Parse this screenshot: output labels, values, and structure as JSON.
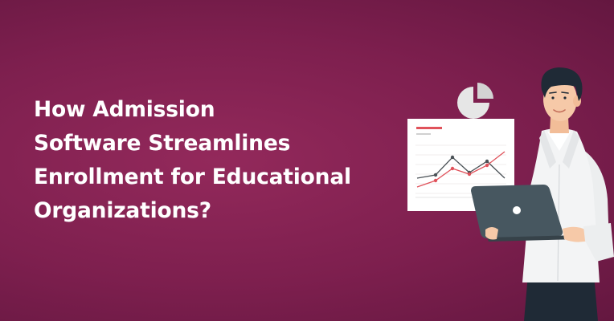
{
  "headline": {
    "lines": [
      "How Admission",
      "Software Streamlines",
      "Enrollment for Educational",
      "Organizations?"
    ]
  },
  "colors": {
    "background": "#7d1f4e",
    "headline_text": "#ffffff",
    "chart_red": "#e0525b",
    "chart_gray": "#4b5257",
    "laptop": "#475760",
    "coat": "#f3f4f5",
    "skin": "#f6c9a8",
    "hair": "#1f2a36"
  },
  "icons": [
    "pie-chart-icon",
    "line-chart-board",
    "laptop-icon",
    "person-illustration"
  ]
}
